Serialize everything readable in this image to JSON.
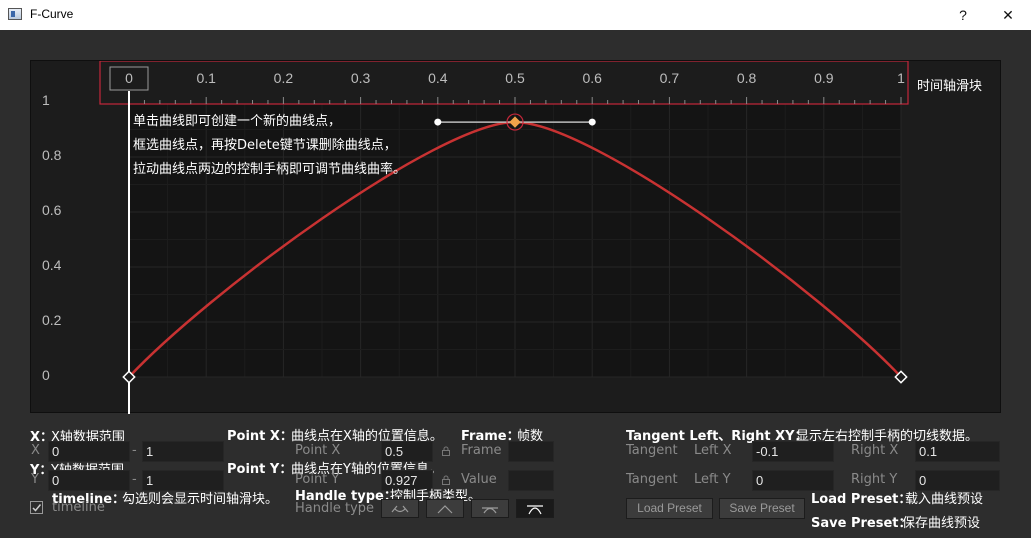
{
  "window": {
    "title": "F-Curve",
    "help_label": "?",
    "close_label": "✕"
  },
  "graph": {
    "y_ticks": [
      "1",
      "0.8",
      "0.6",
      "0.4",
      "0.2",
      "0"
    ],
    "timeline_ticks": [
      "0",
      "0.1",
      "0.2",
      "0.3",
      "0.4",
      "0.5",
      "0.6",
      "0.7",
      "0.8",
      "0.9",
      "1"
    ],
    "timeline_slider_label": "时间轴滑块",
    "curve_color": "#c83232",
    "selected_color": "#f0a24a",
    "hint_lines": [
      "单击曲线即可创建一个新的曲线点，",
      "框选曲线点，再按Delete键节课删除曲线点，",
      "拉动曲线点两边的控制手柄即可调节曲线曲率。"
    ],
    "curve": {
      "points": [
        {
          "x": 0.0,
          "y": 0.0
        },
        {
          "x": 0.5,
          "y": 0.927
        },
        {
          "x": 1.0,
          "y": 0.0
        }
      ],
      "selected_handles": {
        "left": -0.1,
        "right": 0.1
      }
    }
  },
  "notes": {
    "x_range": {
      "key": "X：",
      "text": "X轴数据范围"
    },
    "y_range": {
      "key": "Y：",
      "text": "Y轴数据范围"
    },
    "timeline": {
      "key": "timeline：",
      "text": "勾选则会显示时间轴滑块。"
    },
    "point_x": {
      "key": "Point X：",
      "text": "曲线点在X轴的位置信息。"
    },
    "frame": {
      "key": "Frame：",
      "text": "帧数"
    },
    "point_y": {
      "key": "Point Y：",
      "text": "曲线点在Y轴的位置信息。"
    },
    "handle_type": {
      "key": "Handle type：",
      "text": "控制手柄类型。"
    },
    "tangent": {
      "key": "Tangent Left、Right XY：",
      "text": "显示左右控制手柄的切线数据。"
    },
    "load_preset": {
      "key": "Load Preset：",
      "text": "载入曲线预设"
    },
    "save_preset": {
      "key": "Save Preset：",
      "text": "保存曲线预设"
    }
  },
  "controls": {
    "x_label": "X",
    "x_min": "0",
    "x_dash": "-",
    "x_max": "1",
    "y_label": "Y",
    "y_min": "0",
    "y_dash": "-",
    "y_max": "1",
    "timeline_label": "timeline",
    "timeline_checked": true,
    "point_x_label": "Point X",
    "point_x_value": "0.5",
    "point_y_label": "Point Y",
    "point_y_value": "0.927",
    "frame_label": "Frame",
    "frame_value": "",
    "value_label": "Value",
    "value_value": "",
    "handle_type_label": "Handle type",
    "tangent_label_1": "Tangent",
    "left_x_label": "Left X",
    "left_x_value": "-0.1",
    "right_x_label": "Right X",
    "right_x_value": "0.1",
    "tangent_label_2": "Tangent",
    "left_y_label": "Left Y",
    "left_y_value": "0",
    "right_y_label": "Right Y",
    "right_y_value": "0",
    "load_preset_label": "Load Preset",
    "save_preset_label": "Save Preset"
  }
}
